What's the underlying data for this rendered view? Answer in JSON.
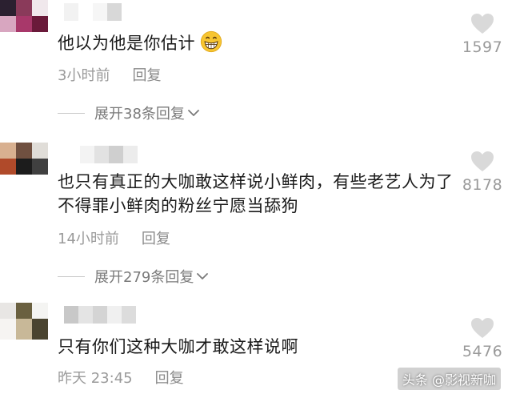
{
  "comments": [
    {
      "text": "他以为他是你估计",
      "has_emoji": true,
      "emoji_icon": "grinning-face-icon",
      "time": "3小时前",
      "reply_label": "回复",
      "expand_label": "展开38条回复",
      "likes": "1597"
    },
    {
      "text": "也只有真正的大咖敢这样说小鲜肉，有些老艺人为了不得罪小鲜肉的粉丝宁愿当舔狗",
      "has_emoji": false,
      "time": "14小时前",
      "reply_label": "回复",
      "expand_label": "展开279条回复",
      "likes": "8178"
    },
    {
      "text": "只有你们这种大咖才敢这样说啊",
      "has_emoji": false,
      "time": "昨天 23:45",
      "reply_label": "回复",
      "likes": "5476"
    }
  ],
  "watermark": "头条 @影视新咖",
  "colors": {
    "text": "#1a1a1a",
    "meta": "#9a9a9a",
    "heart": "#d9d9d9",
    "emoji": "#f7c531"
  }
}
